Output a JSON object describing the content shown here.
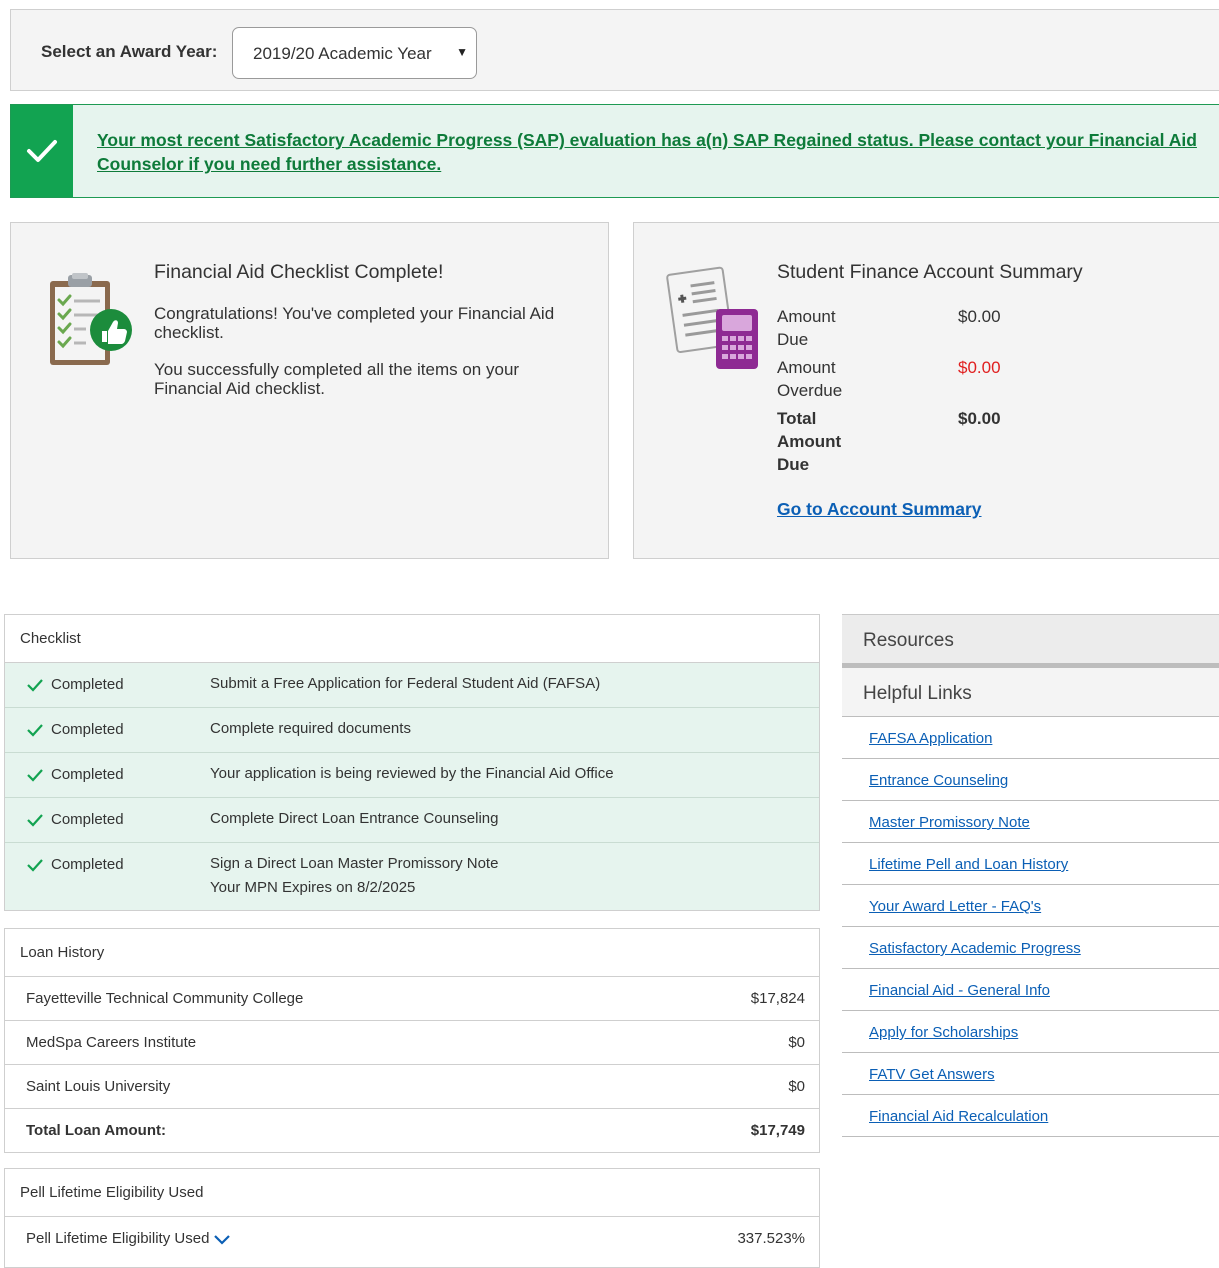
{
  "award_year": {
    "label": "Select an Award Year:",
    "selected": "2019/20 Academic Year"
  },
  "sap_banner": {
    "message": "Your most recent Satisfactory Academic Progress (SAP) evaluation has a(n) SAP Regained status. Please contact your Financial Aid Counselor if you need further assistance."
  },
  "checklist_card": {
    "title": "Financial Aid Checklist Complete!",
    "text1": "Congratulations! You've completed your Financial Aid checklist.",
    "text2": "You successfully completed all the items on your Financial Aid checklist."
  },
  "finance_card": {
    "title": "Student Finance Account Summary",
    "rows": [
      {
        "label": "Amount Due",
        "value": "$0.00"
      },
      {
        "label": "Amount Overdue",
        "value": "$0.00"
      },
      {
        "label": "Total Amount Due",
        "value": "$0.00"
      }
    ],
    "link": "Go to Account Summary",
    "overdue_color": "#e02020"
  },
  "checklist": {
    "heading": "Checklist",
    "items": [
      {
        "status": "Completed",
        "desc": "Submit a Free Application for Federal Student Aid (FAFSA)"
      },
      {
        "status": "Completed",
        "desc": "Complete required documents"
      },
      {
        "status": "Completed",
        "desc": "Your application is being reviewed by the Financial Aid Office"
      },
      {
        "status": "Completed",
        "desc": "Complete Direct Loan Entrance Counseling"
      },
      {
        "status": "Completed",
        "desc": "Sign a Direct Loan Master Promissory Note",
        "sub": "Your MPN Expires on 8/2/2025"
      }
    ]
  },
  "loan_history": {
    "heading": "Loan History",
    "rows": [
      {
        "name": "Fayetteville Technical Community College",
        "amount": "$17,824"
      },
      {
        "name": "MedSpa Careers Institute",
        "amount": "$0"
      },
      {
        "name": "Saint Louis University",
        "amount": "$0"
      }
    ],
    "total_label": "Total Loan Amount:",
    "total_amount": "$17,749"
  },
  "pell": {
    "heading": "Pell Lifetime Eligibility Used",
    "row_label": "Pell Lifetime Eligibility Used",
    "value": "337.523%"
  },
  "resources": {
    "heading": "Resources",
    "helpful_heading": "Helpful Links",
    "links": [
      "FAFSA Application",
      "Entrance Counseling",
      "Master Promissory Note",
      "Lifetime Pell and Loan History",
      "Your Award Letter - FAQ's",
      "Satisfactory Academic Progress",
      "Financial Aid - General Info",
      "Apply for Scholarships",
      "FATV Get Answers",
      "Financial Aid Recalculation"
    ]
  },
  "colors": {
    "success_green": "#12a351",
    "success_bg": "#e6f4ee",
    "link_blue": "#0b5fb5"
  }
}
